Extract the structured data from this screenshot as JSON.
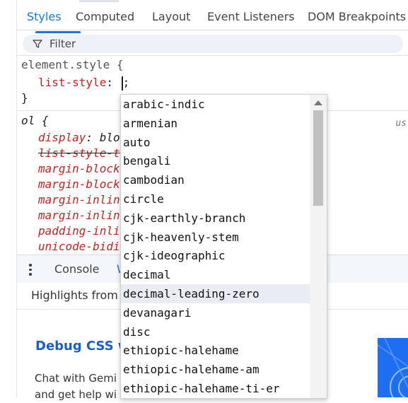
{
  "tabs": [
    "Styles",
    "Computed",
    "Layout",
    "Event Listeners",
    "DOM Breakpoints"
  ],
  "filter": {
    "placeholder": "Filter"
  },
  "styles": {
    "element_selector": "element.style {",
    "editing_prop": "list-style",
    "editing_colon": ":",
    "editing_value": ";",
    "close_brace": "}",
    "ol_selector": "ol {",
    "ua_label": "us",
    "rules": [
      {
        "prop": "display",
        "sep": ": ",
        "value": "blo",
        "strike": false
      },
      {
        "prop": "list-style-t",
        "sep": "",
        "value": "",
        "strike": true
      },
      {
        "prop": "margin-block",
        "sep": "",
        "value": "",
        "strike": false
      },
      {
        "prop": "margin-block",
        "sep": "",
        "value": "",
        "strike": false
      },
      {
        "prop": "margin-inlin",
        "sep": "",
        "value": "",
        "strike": false
      },
      {
        "prop": "margin-inlin",
        "sep": "",
        "value": "",
        "strike": false
      },
      {
        "prop": "padding-inli",
        "sep": "",
        "value": "",
        "strike": false
      },
      {
        "prop": "unicode-bidi",
        "sep": "",
        "value": "",
        "strike": false
      }
    ]
  },
  "drawer": {
    "tabs": [
      "Console",
      "W"
    ],
    "highlights": "Highlights from",
    "debug_title": "Debug CSS w",
    "chat_line1": "Chat with Gemi",
    "chat_line2": "and get help wi"
  },
  "autocomplete": {
    "selected_index": 10,
    "items": [
      "arabic-indic",
      "armenian",
      "auto",
      "bengali",
      "cambodian",
      "circle",
      "cjk-earthly-branch",
      "cjk-heavenly-stem",
      "cjk-ideographic",
      "decimal",
      "decimal-leading-zero",
      "devanagari",
      "disc",
      "ethiopic-halehame",
      "ethiopic-halehame-am",
      "ethiopic-halehame-ti-er"
    ]
  },
  "colors": {
    "accent": "#1a73e8",
    "property": "#c5221f"
  }
}
